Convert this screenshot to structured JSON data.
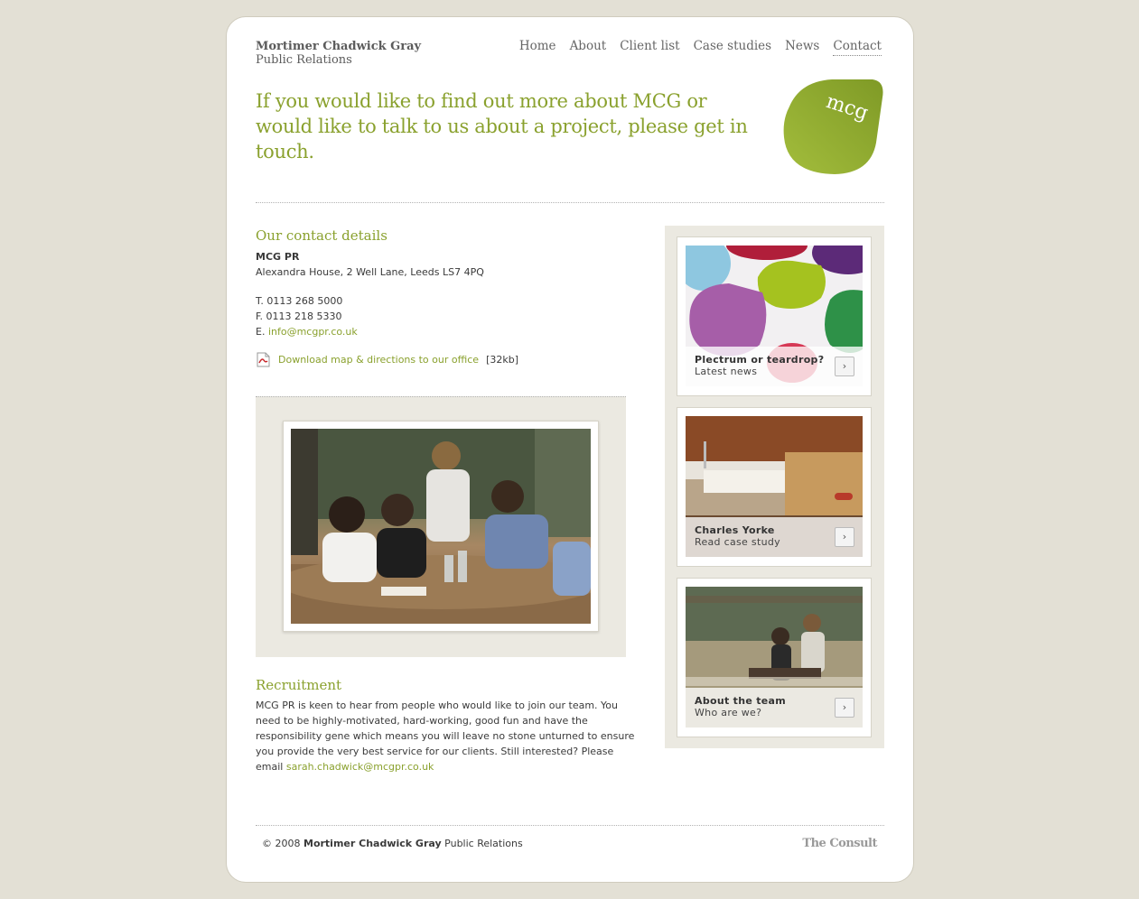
{
  "brand": {
    "line1": "Mortimer Chadwick Gray",
    "line2": "Public Relations",
    "blob_text": "mcg",
    "accent": "#8aa12e"
  },
  "nav": [
    {
      "label": "Home"
    },
    {
      "label": "About"
    },
    {
      "label": "Client list"
    },
    {
      "label": "Case studies"
    },
    {
      "label": "News"
    },
    {
      "label": "Contact"
    }
  ],
  "intro": "If you would like to find out more about MCG or would like to talk to us about a project, please get in touch.",
  "contact": {
    "heading": "Our contact details",
    "company": "MCG PR",
    "address": "Alexandra House, 2 Well Lane, Leeds LS7 4PQ",
    "phone": "T. 0113 268 5000",
    "fax": "F. 0113 218 5330",
    "email_prefix": "E.",
    "email": "info@mcgpr.co.uk",
    "download_link": "Download map & directions to our office",
    "download_size": "[32kb]"
  },
  "recruitment": {
    "heading": "Recruitment",
    "text": "MCG PR is keen to hear from people who would like to join our team. You need to be highly-motivated, hard-working, good fun and have the responsibility gene which means you will leave no stone unturned to ensure you provide the very best service for our clients. Still interested? Please email",
    "email": "sarah.chadwick@mcgpr.co.uk"
  },
  "tiles": [
    {
      "title": "Plectrum or teardrop?",
      "subtitle": "Latest news",
      "arrow": "›"
    },
    {
      "title": "Charles Yorke",
      "subtitle": "Read case study",
      "arrow": "›"
    },
    {
      "title": "About the team",
      "subtitle": "Who are we?",
      "arrow": "›"
    }
  ],
  "footer": {
    "copyright": "© 2008",
    "company": "Mortimer Chadwick Gray",
    "suffix": "Public Relations",
    "credit": "The Consult"
  }
}
